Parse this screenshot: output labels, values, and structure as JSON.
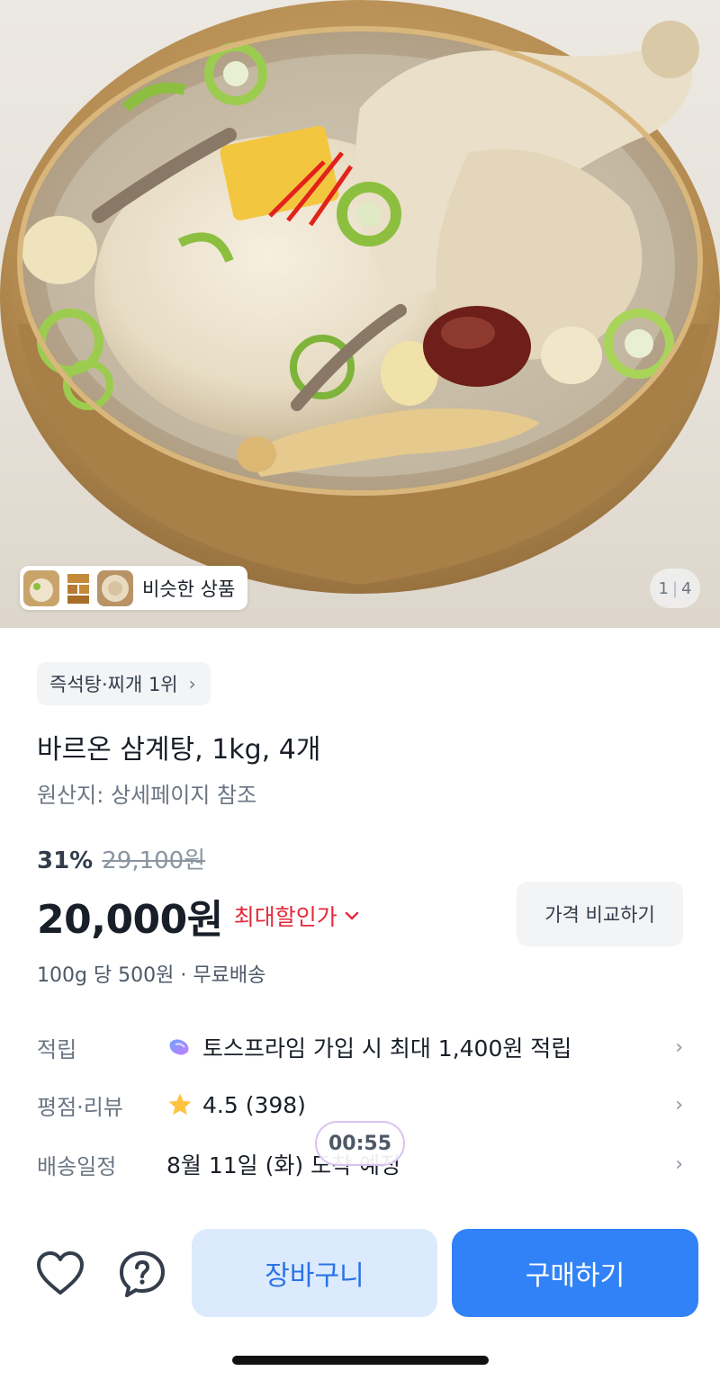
{
  "hero": {
    "image": "samgyetang-bowl-photo",
    "similar_products_label": "비슷한 상품",
    "pager_current": "1",
    "pager_total": "4"
  },
  "product": {
    "rank_chip": "즉석탕·찌개 1위",
    "title": "바르온 삼계탕, 1kg, 4개",
    "origin": "원산지: 상세페이지 참조",
    "discount_rate": "31%",
    "original_price": "29,100원",
    "price": "20,000원",
    "max_discount_label": "최대할인가",
    "compare_button": "가격 비교하기",
    "unit_price_line": "100g 당 500원 · 무료배송"
  },
  "info_rows": {
    "points": {
      "label": "적립",
      "value": "토스프라임 가입 시 최대 1,400원 적립",
      "icon": "toss-prime-icon"
    },
    "rating": {
      "label": "평점·리뷰",
      "value": "4.5 (398)",
      "icon": "star-icon"
    },
    "shipping": {
      "label": "배송일정",
      "value": "8월 11일 (화) 도착 예정"
    }
  },
  "timer": "00:55",
  "bottom_bar": {
    "cart_label": "장바구니",
    "buy_label": "구매하기",
    "heart_icon": "heart-icon",
    "help_icon": "question-icon"
  },
  "colors": {
    "primary": "#3182f6",
    "cart_bg": "#dceafd",
    "discount_red": "#e42939",
    "star": "#ffc342"
  }
}
